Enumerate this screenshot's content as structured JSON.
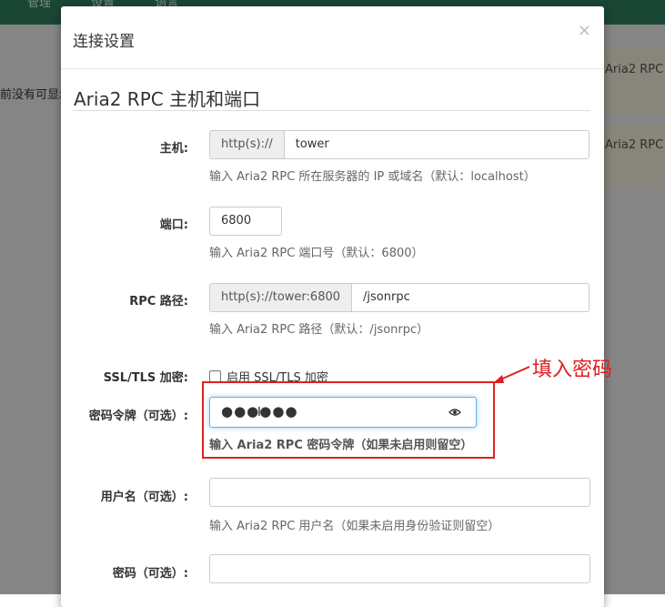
{
  "background": {
    "nav_items": [
      "管理",
      "设置",
      "语言"
    ],
    "left_text": "前没有可显示",
    "card1_text": "Aria2 RPC",
    "card2_text": "Aria2 RPC"
  },
  "modal": {
    "title": "连接设置",
    "close_label": "×",
    "section_title": "Aria2 RPC 主机和端口"
  },
  "host": {
    "label": "主机:",
    "prefix": "http(s)://",
    "value": "tower",
    "help": "输入 Aria2 RPC 所在服务器的 IP 或域名（默认：localhost）"
  },
  "port": {
    "label": "端口:",
    "value": "6800",
    "help": "输入 Aria2 RPC 端口号（默认：6800）"
  },
  "rpc_path": {
    "label": "RPC 路径:",
    "prefix": "http(s)://tower:6800",
    "value": "/jsonrpc",
    "help": "输入 Aria2 RPC 路径（默认：/jsonrpc）"
  },
  "ssl": {
    "label": "SSL/TLS 加密:",
    "checkbox_label": "启用 SSL/TLS 加密",
    "checked": false
  },
  "secret": {
    "label": "密码令牌（可选）:",
    "value": "●●●●●●",
    "help": "输入 Aria2 RPC 密码令牌（如果未启用则留空）"
  },
  "username": {
    "label": "用户名（可选）:",
    "value": "",
    "help": "输入 Aria2 RPC 用户名（如果未启用身份验证则留空）"
  },
  "password": {
    "label": "密码（可选）:",
    "value": ""
  },
  "annotation": {
    "text": "填入密码",
    "color": "#e02020"
  },
  "colors": {
    "topbar": "#30805f",
    "focus": "#66afe9"
  }
}
